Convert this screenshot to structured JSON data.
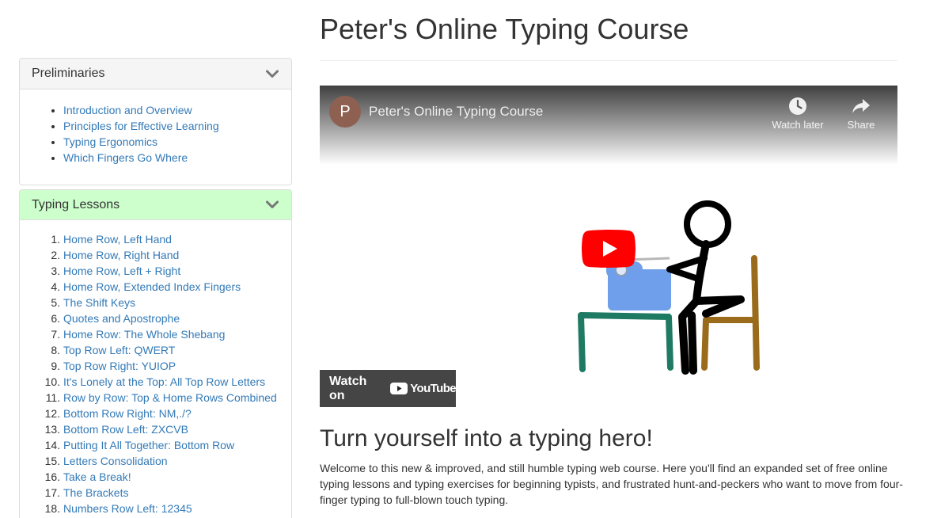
{
  "page": {
    "title": "Peter's Online Typing Course"
  },
  "sidebar": {
    "preliminaries": {
      "title": "Preliminaries",
      "items": [
        "Introduction and Overview",
        "Principles for Effective Learning",
        "Typing Ergonomics",
        "Which Fingers Go Where"
      ]
    },
    "lessons": {
      "title": "Typing Lessons",
      "items": [
        "Home Row, Left Hand",
        "Home Row, Right Hand",
        "Home Row, Left + Right",
        "Home Row, Extended Index Fingers",
        "The Shift Keys",
        "Quotes and Apostrophe",
        "Home Row: The Whole Shebang",
        "Top Row Left: QWERT",
        "Top Row Right: YUIOP",
        "It's Lonely at the Top: All Top Row Letters",
        "Row by Row: Top & Home Rows Combined",
        "Bottom Row Right: NM,./?",
        "Bottom Row Left: ZXCVB",
        "Putting It All Together: Bottom Row",
        "Letters Consolidation",
        "Take a Break!",
        "The Brackets",
        "Numbers Row Left: 12345"
      ]
    }
  },
  "video": {
    "channel_initial": "P",
    "title": "Peter's Online Typing Course",
    "watch_later_label": "Watch later",
    "share_label": "Share",
    "watch_on_label": "Watch on",
    "youtube_label": "YouTube"
  },
  "main": {
    "hero_heading": "Turn yourself into a typing hero!",
    "intro": "Welcome to this new & improved, and still humble typing web course. Here you'll find an expanded set of free online typing lessons and typing exercises for beginning typists, and frustrated hunt-and-peckers who want to move from four-finger typing to full-blown touch typing."
  },
  "colors": {
    "link": "#337ab7",
    "lessons_header_bg": "#ccffcc",
    "preliminaries_header_bg": "#f5f5f5",
    "youtube_red": "#ff0000"
  },
  "icons": {
    "panel_toggle": "chevron-down-icon",
    "watch_later": "clock-icon",
    "share": "share-arrow-icon",
    "play": "play-icon",
    "youtube": "youtube-logo-icon"
  }
}
